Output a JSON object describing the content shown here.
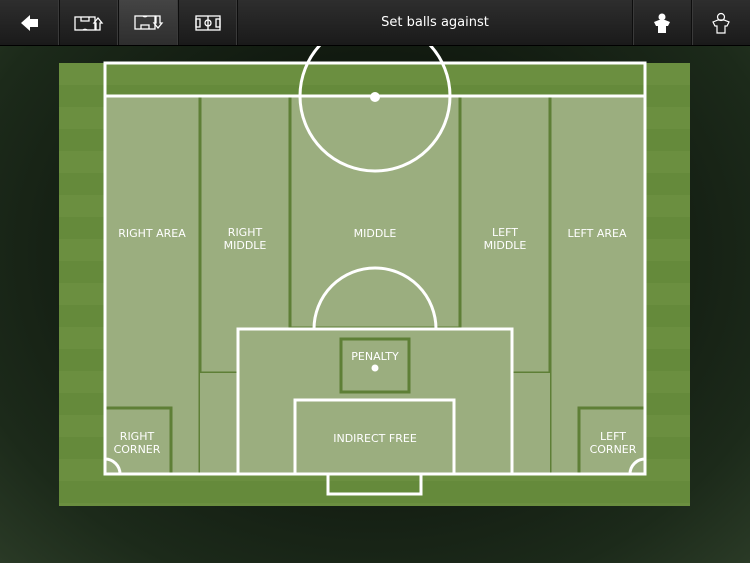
{
  "toolbar": {
    "title": "Set balls against",
    "buttons": [
      {
        "icon": "back-arrow-icon"
      },
      {
        "icon": "field-attack-icon"
      },
      {
        "icon": "field-defend-icon",
        "active": true
      },
      {
        "icon": "full-field-icon"
      },
      {
        "icon": "player-filled-icon"
      },
      {
        "icon": "player-outline-icon"
      }
    ]
  },
  "zones": {
    "right_area": "RIGHT AREA",
    "right_middle": [
      "RIGHT",
      "MIDDLE"
    ],
    "middle": "MIDDLE",
    "left_middle": [
      "LEFT",
      "MIDDLE"
    ],
    "left_area": "LEFT AREA",
    "penalty": "PENALTY",
    "indirect_free": "INDIRECT FREE",
    "right_corner": [
      "RIGHT",
      "CORNER"
    ],
    "left_corner": [
      "LEFT",
      "CORNER"
    ]
  },
  "colors": {
    "grass": "#6b8f40",
    "zone": "#9bae7f",
    "zone_line": "#5e7f36",
    "line": "#ffffff"
  }
}
